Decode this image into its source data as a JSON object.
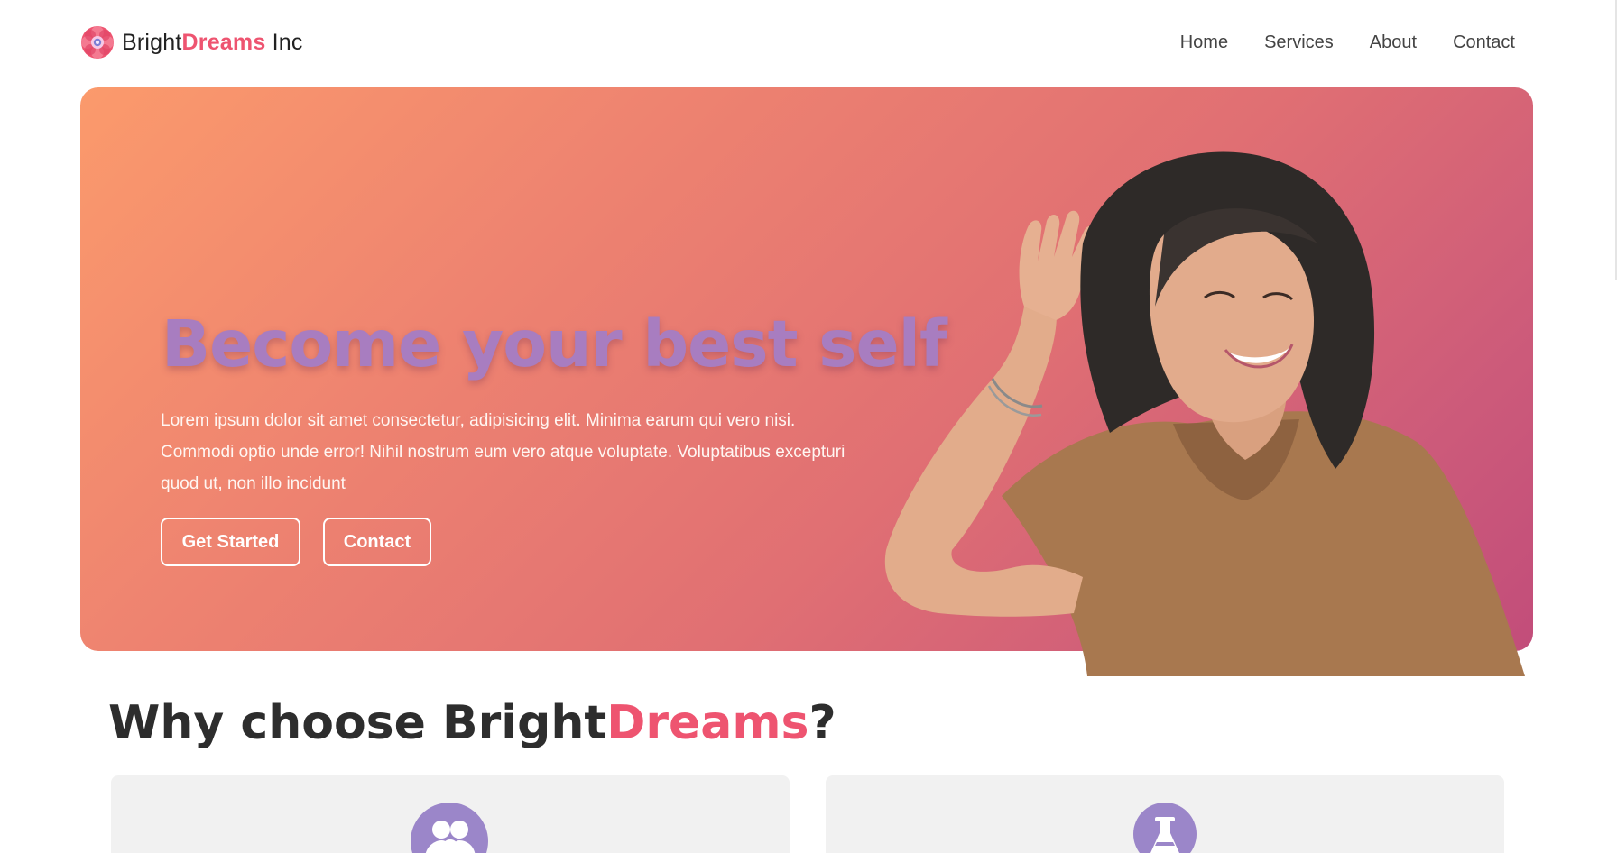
{
  "header": {
    "brand": {
      "prefix": "Bright",
      "accent": "Dreams",
      "suffix": " Inc",
      "logo_icon": "flower-logo-icon"
    },
    "nav": [
      {
        "label": "Home"
      },
      {
        "label": "Services"
      },
      {
        "label": "About"
      },
      {
        "label": "Contact"
      }
    ]
  },
  "hero": {
    "title": "Become your best self",
    "description": "Lorem ipsum dolor sit amet consectetur, adipisicing elit. Minima earum qui vero nisi. Commodi optio unde error! Nihil nostrum eum vero atque voluptate. Voluptatibus excepturi quod ut, non illo incidunt",
    "buttons": {
      "primary": "Get Started",
      "secondary": "Contact"
    },
    "gradient": [
      "#fb9a6c",
      "#c24d7a"
    ],
    "title_color": "#a87dc0"
  },
  "section": {
    "title_prefix": "Why choose Bright",
    "title_accent": "Dreams",
    "title_suffix": "?",
    "cards": [
      {
        "icon": "users-icon"
      },
      {
        "icon": "flask-icon"
      }
    ]
  },
  "colors": {
    "accent": "#ee5470",
    "icon_circle": "#9b86c9",
    "card_bg": "#f1f1f1"
  }
}
